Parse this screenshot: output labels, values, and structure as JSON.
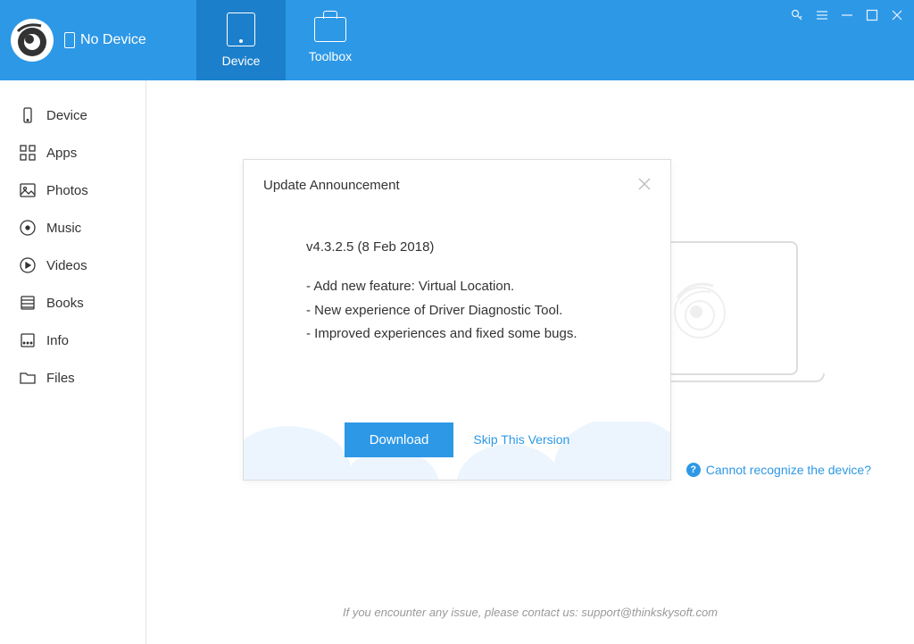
{
  "header": {
    "device_status": "No Device",
    "tabs": [
      {
        "label": "Device"
      },
      {
        "label": "Toolbox"
      }
    ]
  },
  "sidebar": {
    "items": [
      {
        "label": "Device"
      },
      {
        "label": "Apps"
      },
      {
        "label": "Photos"
      },
      {
        "label": "Music"
      },
      {
        "label": "Videos"
      },
      {
        "label": "Books"
      },
      {
        "label": "Info"
      },
      {
        "label": "Files"
      }
    ]
  },
  "help": {
    "link_text": "Cannot recognize the device?"
  },
  "footer": {
    "text": "If you encounter any issue, please contact us: support@thinkskysoft.com"
  },
  "modal": {
    "title": "Update Announcement",
    "version_line": "v4.3.2.5 (8 Feb 2018)",
    "changes": [
      "- Add new feature: Virtual Location.",
      "- New experience of Driver Diagnostic Tool.",
      "- Improved experiences and fixed some bugs."
    ],
    "download_label": "Download",
    "skip_label": "Skip This Version"
  }
}
